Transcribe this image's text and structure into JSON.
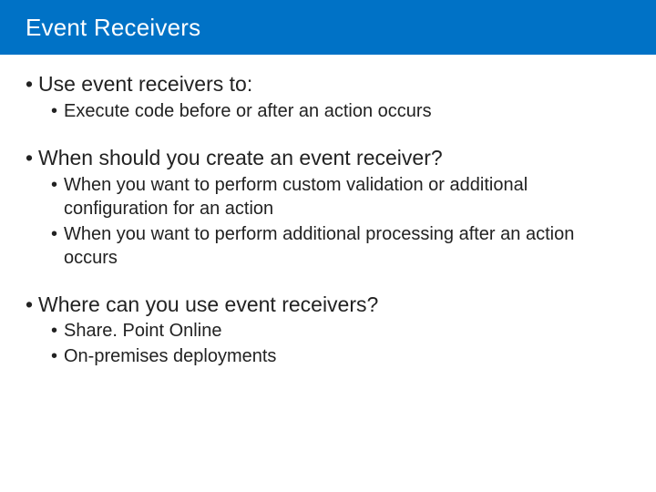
{
  "title": "Event Receivers",
  "sections": [
    {
      "heading": "Use event receivers to:",
      "items": [
        "Execute code before or after an action occurs"
      ]
    },
    {
      "heading": "When should you create an event receiver?",
      "items": [
        "When you want to perform custom validation or additional configuration for an action",
        "When you want to perform additional processing after an action occurs"
      ]
    },
    {
      "heading": "Where can you use event receivers?",
      "items": [
        "Share. Point Online",
        "On-premises deployments"
      ]
    }
  ]
}
